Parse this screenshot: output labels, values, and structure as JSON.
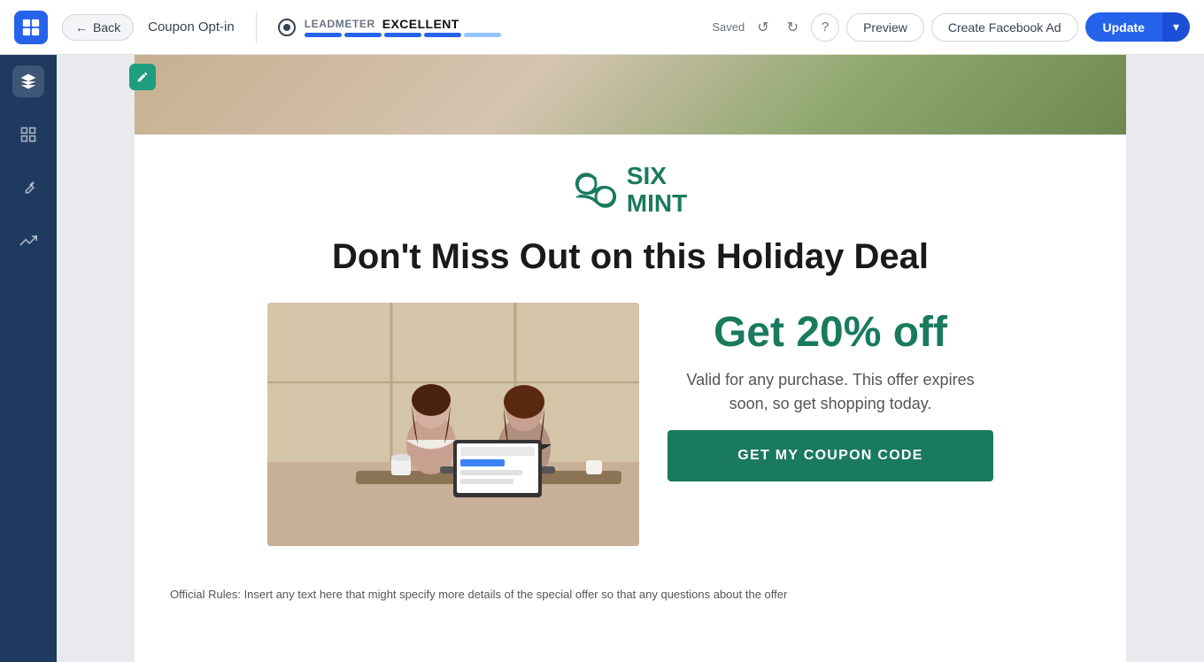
{
  "topbar": {
    "back_label": "Back",
    "page_title": "Coupon Opt-in",
    "leadmeter_label": "LEADMETER",
    "leadmeter_status": "EXCELLENT",
    "saved_text": "Saved",
    "preview_label": "Preview",
    "create_fb_ad_label": "Create Facebook Ad",
    "update_label": "Update"
  },
  "sidebar": {
    "icons": [
      "layers",
      "grid",
      "pen",
      "trending-up"
    ]
  },
  "content": {
    "brand_name_line1": "SIX",
    "brand_name_line2": "MINT",
    "headline": "Don't Miss Out on this Holiday Deal",
    "discount": "Get 20% off",
    "offer_desc": "Valid for any purchase. This offer expires soon, so get shopping today.",
    "cta_button": "GET MY COUPON CODE",
    "fine_print": "Official Rules: Insert any text here that might specify more details of the special offer so that any questions about the offer"
  },
  "progress_segments": [
    {
      "filled": true
    },
    {
      "filled": true
    },
    {
      "filled": true
    },
    {
      "filled": true
    },
    {
      "filled": false
    }
  ]
}
